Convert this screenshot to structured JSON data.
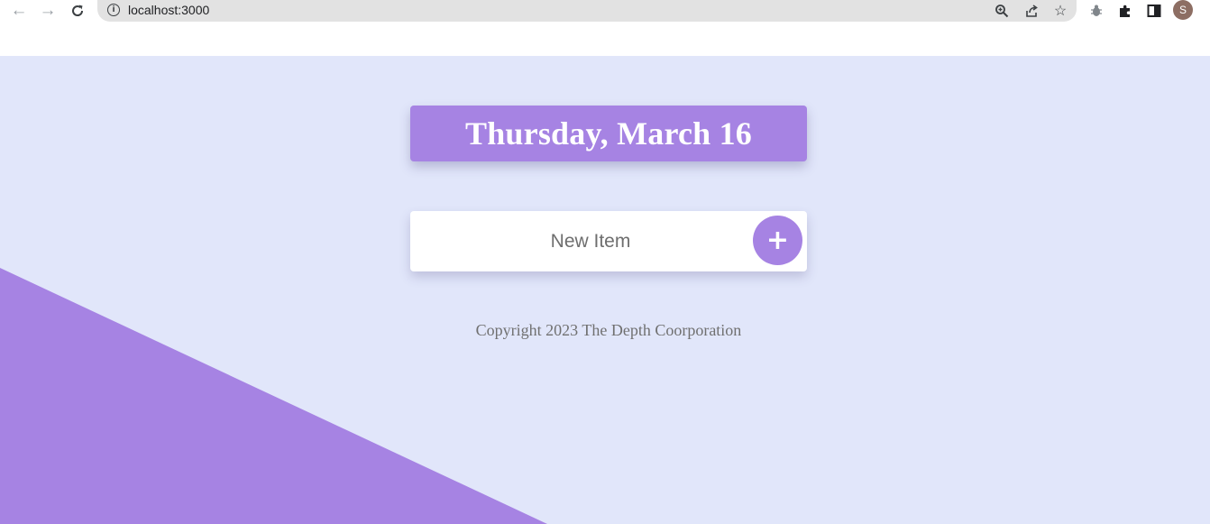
{
  "browser": {
    "url": "localhost:3000",
    "icons": {
      "back": "arrow-left-icon",
      "forward": "arrow-right-icon",
      "reload": "reload-icon",
      "site_info": "info-icon",
      "zoom": "zoom-icon",
      "share": "share-icon",
      "bookmark": "star-icon",
      "extension_bug": "bug-icon",
      "extensions": "puzzle-icon",
      "side_panel": "side-panel-icon"
    },
    "profile_initial": "S"
  },
  "app": {
    "heading": "Thursday, March 16",
    "new_item_placeholder": "New Item",
    "add_button_label": "+",
    "footer": "Copyright 2023 The Depth Coorporation"
  },
  "colors": {
    "accent": "#a683e3",
    "page_background": "#e1e6fa",
    "card": "#ffffff"
  }
}
